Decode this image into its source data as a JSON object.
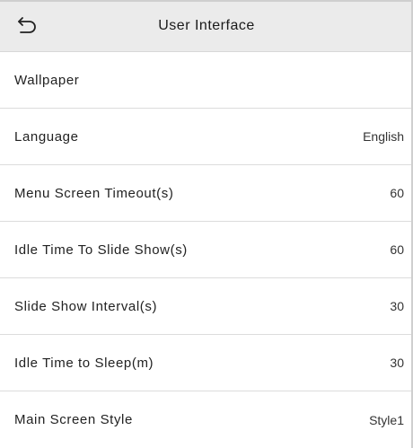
{
  "header": {
    "title": "User Interface",
    "back_icon": "back-arrow-icon"
  },
  "menu": {
    "items": [
      {
        "label": "Wallpaper",
        "value": ""
      },
      {
        "label": "Language",
        "value": "English"
      },
      {
        "label": "Menu Screen Timeout(s)",
        "value": "60"
      },
      {
        "label": "Idle Time To Slide Show(s)",
        "value": "60"
      },
      {
        "label": "Slide Show Interval(s)",
        "value": "30"
      },
      {
        "label": "Idle Time to Sleep(m)",
        "value": "30"
      },
      {
        "label": "Main Screen Style",
        "value": "Style1"
      }
    ]
  },
  "colors": {
    "header_bg": "#ebebeb",
    "divider": "#dcdcdc",
    "text": "#222222"
  }
}
